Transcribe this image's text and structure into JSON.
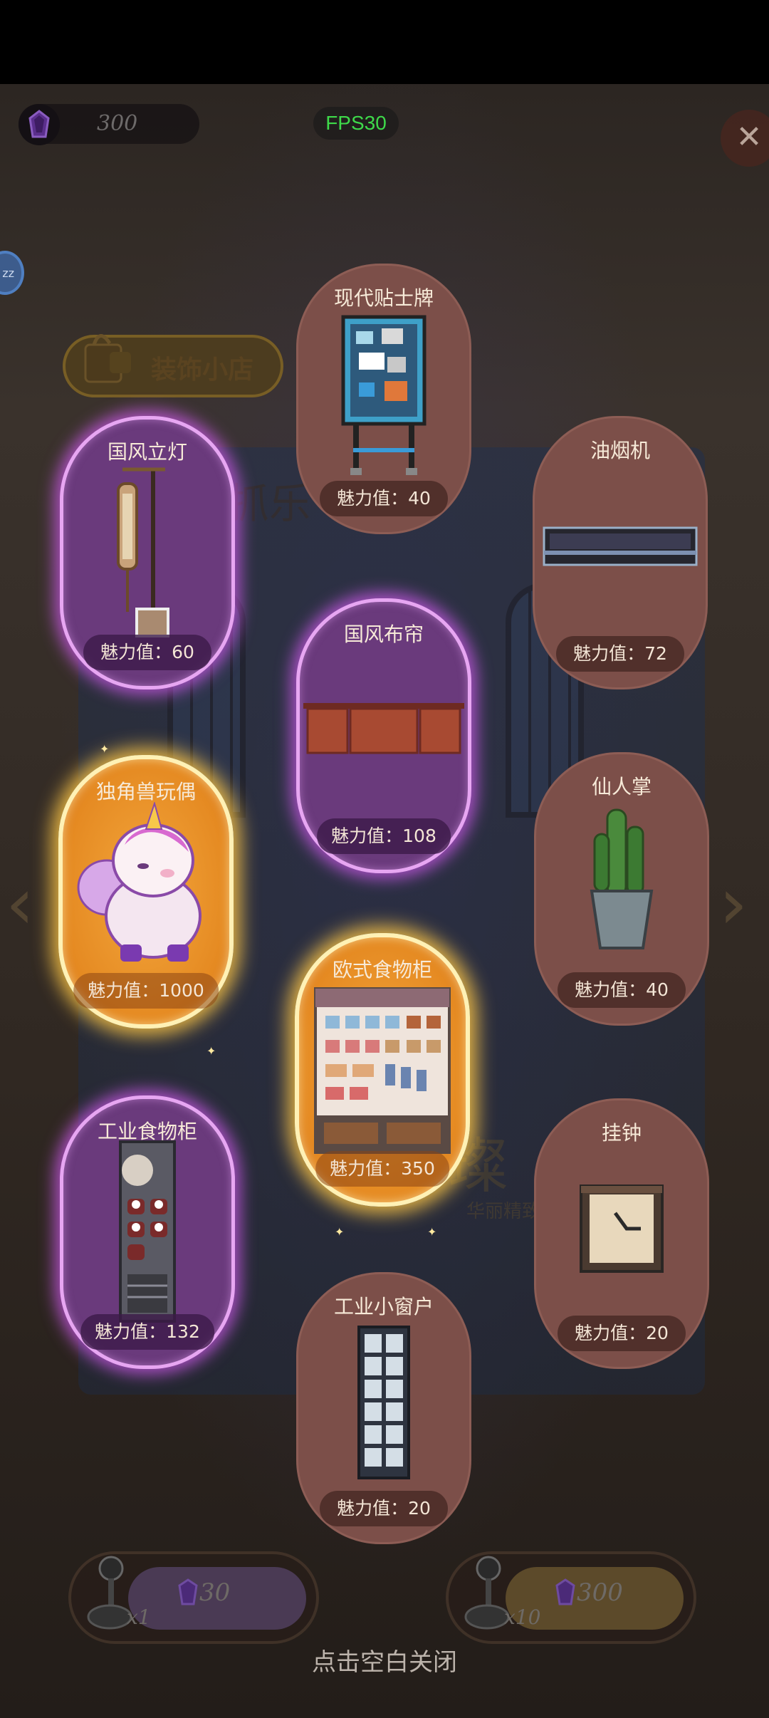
{
  "hud": {
    "currency_value": "300",
    "fps_label": "FPS30",
    "close_glyph": "✕",
    "zz_label": "zz"
  },
  "shop": {
    "title": "装饰小店"
  },
  "background": {
    "banner_text": "抓乐",
    "gem_text": "璨",
    "gem_sub": "华丽精致"
  },
  "cards": [
    {
      "name": "现代贴士牌",
      "value": "魅力值：40",
      "rarity": "normal",
      "icon": "bulletin-board-icon"
    },
    {
      "name": "国风立灯",
      "value": "魅力值：60",
      "rarity": "purple",
      "icon": "standing-lamp-icon"
    },
    {
      "name": "油烟机",
      "value": "魅力值：72",
      "rarity": "normal",
      "icon": "range-hood-icon"
    },
    {
      "name": "国风布帘",
      "value": "魅力值：108",
      "rarity": "purple",
      "icon": "curtain-icon"
    },
    {
      "name": "独角兽玩偶",
      "value": "魅力值：1000",
      "rarity": "gold",
      "icon": "unicorn-plush-icon"
    },
    {
      "name": "仙人掌",
      "value": "魅力值：40",
      "rarity": "normal",
      "icon": "cactus-icon"
    },
    {
      "name": "欧式食物柜",
      "value": "魅力值：350",
      "rarity": "gold",
      "icon": "food-cabinet-icon"
    },
    {
      "name": "工业食物柜",
      "value": "魅力值：132",
      "rarity": "purple",
      "icon": "industrial-cabinet-icon"
    },
    {
      "name": "挂钟",
      "value": "魅力值：20",
      "rarity": "normal",
      "icon": "wall-clock-icon"
    },
    {
      "name": "工业小窗户",
      "value": "魅力值：20",
      "rarity": "normal",
      "icon": "window-icon"
    }
  ],
  "draw_buttons": [
    {
      "multiplier": "x1",
      "price": "30"
    },
    {
      "multiplier": "x10",
      "price": "300"
    }
  ],
  "footer": {
    "hint": "点击空白关闭"
  },
  "colors": {
    "purple_glow": "#e7a6f2",
    "gold_glow": "#fff1b5",
    "card_base": "#7c4f49",
    "fps_green": "#3ed94a"
  }
}
